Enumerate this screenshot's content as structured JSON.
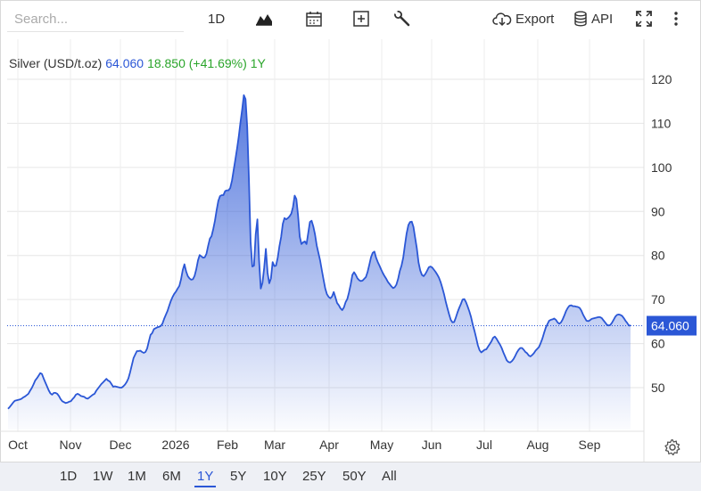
{
  "toolbar": {
    "search_placeholder": "Search...",
    "interval_label": "1D",
    "export_label": "Export",
    "api_label": "API",
    "icons": [
      "chart-type-icon",
      "calendar-icon",
      "add-indicator-icon",
      "wrench-icon",
      "cloud-download-icon",
      "database-icon",
      "fullscreen-icon",
      "more-vertical-icon"
    ]
  },
  "legend": {
    "symbol": "Silver (USD/t.oz)",
    "price": "64.060",
    "change": "18.850 (+41.69%)",
    "period": "1Y"
  },
  "range_buttons": [
    "1D",
    "1W",
    "1M",
    "6M",
    "1Y",
    "5Y",
    "10Y",
    "25Y",
    "50Y",
    "All"
  ],
  "active_range": "1Y",
  "colors": {
    "line": "#2b57d6",
    "up": "#2aa52a",
    "price_label": "#2b57d6"
  },
  "chart_data": {
    "type": "area",
    "title": "Silver (USD/t.oz)",
    "last_value": 64.06,
    "last_value_label": "64.060",
    "x_tick_labels": [
      "Oct",
      "Nov",
      "Dec",
      "2026",
      "Feb",
      "Mar",
      "Apr",
      "May",
      "Jun",
      "Jul",
      "Aug",
      "Sep"
    ],
    "y_tick_labels": [
      "120",
      "110",
      "100",
      "90",
      "80",
      "70",
      "60",
      "50"
    ],
    "ylim": [
      40,
      123
    ],
    "y_axis_position": "right",
    "grid": true,
    "x": [
      "Oct",
      "",
      "",
      "",
      "",
      "",
      "",
      "",
      "",
      "",
      "",
      "",
      "",
      "",
      "",
      "",
      "",
      "",
      "",
      "",
      "",
      "",
      "",
      "",
      "",
      "",
      "",
      "",
      "",
      "",
      "",
      "",
      "",
      "",
      "",
      "",
      "",
      "",
      "",
      "",
      "",
      "",
      "",
      "Nov",
      "",
      "",
      "",
      "",
      "",
      "",
      "",
      "",
      "",
      "",
      "",
      "",
      "",
      "",
      "",
      "",
      "",
      "",
      "",
      "",
      "",
      "",
      "",
      "",
      "",
      "",
      "",
      "",
      "",
      "",
      "",
      "",
      "",
      "",
      "",
      "",
      "",
      "",
      "",
      "",
      "",
      "",
      "",
      "Dec",
      "",
      "",
      "",
      "",
      "",
      "",
      "",
      "",
      "",
      "",
      "",
      "",
      "",
      "",
      "",
      "",
      "",
      "",
      "",
      "",
      "",
      "",
      "",
      "",
      "",
      "",
      "",
      "",
      "",
      "",
      "",
      "",
      "",
      "",
      "",
      "",
      "",
      "",
      "",
      "",
      "",
      "",
      "",
      "2026",
      "",
      "",
      "",
      "",
      "",
      "",
      "",
      "",
      "",
      "",
      "",
      "",
      "",
      "",
      "",
      "",
      "",
      "",
      "",
      "",
      "",
      "",
      "",
      "",
      "",
      "",
      "",
      "",
      "",
      "",
      "",
      "",
      "",
      "",
      "",
      "",
      "",
      "",
      "",
      "",
      "",
      "",
      "",
      "",
      "",
      "Feb",
      "",
      "",
      "",
      "",
      "",
      "",
      "",
      "",
      "",
      "",
      "",
      "",
      "",
      "",
      "",
      "",
      "",
      "",
      "",
      "",
      "",
      "",
      "",
      "",
      "",
      "",
      "",
      "",
      "",
      "",
      "",
      "",
      "",
      "",
      "",
      "",
      "",
      "",
      "",
      "",
      "",
      "",
      "Mar",
      "",
      "",
      "",
      "",
      "",
      "",
      "",
      "",
      "",
      "",
      "",
      "",
      "",
      "",
      "",
      "",
      "",
      "",
      "",
      "",
      "",
      "",
      "",
      "",
      "",
      "",
      "",
      "",
      "",
      "",
      "",
      "",
      "",
      "",
      "",
      "",
      "",
      "",
      "",
      "",
      "",
      "",
      "",
      "",
      "Apr",
      "",
      "",
      "",
      "",
      "",
      "",
      "",
      "",
      "",
      "",
      "",
      "",
      "",
      "",
      "",
      "",
      "",
      "",
      "",
      "",
      "",
      "",
      "",
      "",
      "",
      "",
      "",
      "",
      "",
      "",
      "",
      "",
      "",
      "",
      "",
      "",
      "",
      "",
      "",
      "",
      "",
      "",
      "",
      "May",
      "",
      "",
      "",
      "",
      "",
      "",
      "",
      "",
      "",
      "",
      "",
      "",
      "",
      "",
      "",
      "",
      "",
      "",
      "",
      "",
      "",
      "",
      "",
      "",
      "",
      "",
      "",
      "",
      "",
      "",
      "",
      "",
      "",
      "",
      "",
      "",
      "",
      "",
      "",
      "",
      "",
      "",
      "",
      "",
      "Jun",
      "",
      "",
      "",
      "",
      "",
      "",
      "",
      "",
      "",
      "",
      "",
      "",
      "",
      "",
      "",
      "",
      "",
      "",
      "",
      "",
      "",
      "",
      "",
      "",
      "",
      "",
      "",
      "",
      "",
      "",
      "",
      "",
      "",
      "",
      "",
      "",
      "",
      "",
      "",
      "",
      "",
      "",
      "",
      "Jul",
      "",
      "",
      "",
      "",
      "",
      "",
      "",
      "",
      "",
      "",
      "",
      "",
      "",
      "",
      "",
      "",
      "",
      "",
      "",
      "",
      "",
      "",
      "",
      "",
      "",
      "",
      "",
      "",
      "",
      "",
      "",
      "",
      "",
      "",
      "",
      "",
      "",
      "",
      "",
      "",
      "",
      "",
      "",
      "",
      "Aug",
      "",
      "",
      "",
      "",
      "",
      "",
      "",
      "",
      "",
      "",
      "",
      "",
      "",
      "",
      "",
      "",
      "",
      "",
      "",
      "",
      "",
      "",
      "",
      "",
      "",
      "",
      "",
      "",
      "",
      "",
      "",
      "",
      "",
      "",
      "",
      "",
      "",
      "",
      "",
      "",
      "",
      "",
      "",
      "",
      "Sep",
      "",
      "",
      "",
      "",
      "",
      "",
      "",
      "",
      "",
      "",
      "",
      "",
      "",
      "",
      "",
      "",
      "",
      "",
      "",
      "",
      "",
      "",
      "",
      "",
      "",
      "",
      "",
      "",
      "",
      "",
      "",
      "",
      "",
      "",
      "",
      "",
      "",
      "",
      "",
      "",
      "",
      "",
      ""
    ],
    "values_note": "",
    "series": [
      {
        "values": [
          45.2,
          45.6,
          46.1,
          46.6,
          47.0,
          47.1,
          47.2,
          47.3,
          47.5,
          47.8,
          48.0,
          48.3,
          48.6,
          49.3,
          49.9,
          50.7,
          51.6,
          52.1,
          52.7,
          53.3,
          53.1,
          52.1,
          51.2,
          50.3,
          49.4,
          48.7,
          48.4,
          48.8,
          48.8,
          48.6,
          48.1,
          47.4,
          46.9,
          46.7,
          46.5,
          46.6,
          46.8,
          46.9,
          47.4,
          47.8,
          48.4,
          48.6,
          48.4,
          48.1,
          48.0,
          47.9,
          47.6,
          47.5,
          47.8,
          48.1,
          48.4,
          48.6,
          49.3,
          49.8,
          50.3,
          50.8,
          51.2,
          51.6,
          52.0,
          51.6,
          51.4,
          50.8,
          50.2,
          50.3,
          50.2,
          50.1,
          50.0,
          50.0,
          50.3,
          50.7,
          51.3,
          52.1,
          53.5,
          55.1,
          56.7,
          57.5,
          58.3,
          58.3,
          58.4,
          58.1,
          57.9,
          58.1,
          58.9,
          60.5,
          62.0,
          62.4,
          63.3,
          63.5,
          63.7,
          63.8,
          64.0,
          64.5,
          65.6,
          66.5,
          67.4,
          68.6,
          69.7,
          70.6,
          71.3,
          71.8,
          72.5,
          73.1,
          74.6,
          76.7,
          78.0,
          76.4,
          75.3,
          74.8,
          74.5,
          74.6,
          75.4,
          76.9,
          78.9,
          80.1,
          79.8,
          79.5,
          79.6,
          80.4,
          82.2,
          83.8,
          84.4,
          86.0,
          87.9,
          90.3,
          92.4,
          93.5,
          93.7,
          93.7,
          94.6,
          94.8,
          94.8,
          95.3,
          97.0,
          99.4,
          101.8,
          104.3,
          107.0,
          110.2,
          113.1,
          116.4,
          115.5,
          109.2,
          97.4,
          83.1,
          77.5,
          77.7,
          84.8,
          88.2,
          78.9,
          72.5,
          73.8,
          77.2,
          81.5,
          76.1,
          73.7,
          74.8,
          78.5,
          77.6,
          77.7,
          79.5,
          82.1,
          84.2,
          87.2,
          88.5,
          88.2,
          88.5,
          88.9,
          89.5,
          91.0,
          93.6,
          92.8,
          89.1,
          84.3,
          82.6,
          83.0,
          83.2,
          82.6,
          85.1,
          87.6,
          87.9,
          86.6,
          84.8,
          82.3,
          80.6,
          78.8,
          76.6,
          74.5,
          72.5,
          71.2,
          70.6,
          70.3,
          70.7,
          71.7,
          70.5,
          69.2,
          68.7,
          68.0,
          67.6,
          68.2,
          69.4,
          70.1,
          71.6,
          73.4,
          75.6,
          76.2,
          75.6,
          74.8,
          74.4,
          74.2,
          74.3,
          74.7,
          75.1,
          76.3,
          77.9,
          79.6,
          80.6,
          80.9,
          79.5,
          78.5,
          77.7,
          76.8,
          76.0,
          75.3,
          74.7,
          74.0,
          73.5,
          73.0,
          72.6,
          72.8,
          73.4,
          74.7,
          76.5,
          77.7,
          79.5,
          82.3,
          85.0,
          86.9,
          87.6,
          87.7,
          86.5,
          84.0,
          81.6,
          78.4,
          76.6,
          75.6,
          75.3,
          75.8,
          76.5,
          77.3,
          77.5,
          77.3,
          76.8,
          76.3,
          75.7,
          75.0,
          74.0,
          72.7,
          71.3,
          69.6,
          68.1,
          66.7,
          65.4,
          64.8,
          64.9,
          65.9,
          67.1,
          68.1,
          69.0,
          70.0,
          70.1,
          69.4,
          68.4,
          67.3,
          66.0,
          64.3,
          62.9,
          61.3,
          59.6,
          58.5,
          58.0,
          58.3,
          58.6,
          58.7,
          59.3,
          59.9,
          60.5,
          61.3,
          61.6,
          61.1,
          60.4,
          59.8,
          59.0,
          58.0,
          57.1,
          56.2,
          55.8,
          55.7,
          56.0,
          56.5,
          57.2,
          58.0,
          58.6,
          59.0,
          59.0,
          58.6,
          58.1,
          57.8,
          57.3,
          57.1,
          57.4,
          57.8,
          58.4,
          58.8,
          59.2,
          60.1,
          61.1,
          62.4,
          63.6,
          64.4,
          65.2,
          65.4,
          65.5,
          65.7,
          65.4,
          64.8,
          64.5,
          64.8,
          65.5,
          66.4,
          67.4,
          68.1,
          68.6,
          68.7,
          68.5,
          68.5,
          68.4,
          68.3,
          68.1,
          67.5,
          66.6,
          65.9,
          65.2,
          65.1,
          65.3,
          65.6,
          65.7,
          65.8,
          65.9,
          66.0,
          66.0,
          65.8,
          65.3,
          64.8,
          64.3,
          64.1,
          64.2,
          64.7,
          65.4,
          66.1,
          66.5,
          66.6,
          66.5,
          66.3,
          65.8,
          65.2,
          64.7,
          64.1,
          64.1
        ]
      }
    ]
  }
}
